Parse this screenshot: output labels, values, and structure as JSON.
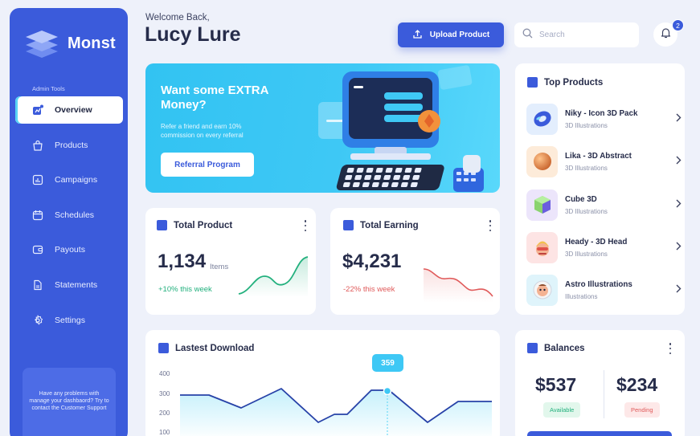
{
  "app": {
    "name": "Monst"
  },
  "sidebar": {
    "section_label": "Admin Tools",
    "items": [
      {
        "label": "Overview",
        "icon": "overview-icon",
        "active": true
      },
      {
        "label": "Products",
        "icon": "bag-icon"
      },
      {
        "label": "Campaigns",
        "icon": "chart-icon"
      },
      {
        "label": "Schedules",
        "icon": "calendar-icon"
      },
      {
        "label": "Payouts",
        "icon": "wallet-icon"
      },
      {
        "label": "Statements",
        "icon": "document-icon"
      },
      {
        "label": "Settings",
        "icon": "gear-icon"
      }
    ],
    "help_text": "Have any problems with manage your dashbaord? Try to contact the Customer Support"
  },
  "header": {
    "welcome": "Welcome Back,",
    "username": "Lucy Lure",
    "upload_label": "Upload Product",
    "search_placeholder": "Search",
    "notification_count": "2"
  },
  "promo": {
    "title": "Want some EXTRA Money?",
    "subtitle": "Refer a friend and earn 10% commission on every referral",
    "button": "Referral Program"
  },
  "total_product": {
    "title": "Total Product",
    "value": "1,134",
    "unit": "Items",
    "change": "+10% this week"
  },
  "total_earning": {
    "title": "Total Earning",
    "value": "$4,231",
    "change": "-22% this week"
  },
  "top_products": {
    "title": "Top Products",
    "items": [
      {
        "name": "Niky - Icon 3D Pack",
        "category": "3D Illustrations"
      },
      {
        "name": "Lika - 3D Abstract",
        "category": "3D Illustrations"
      },
      {
        "name": "Cube 3D",
        "category": "3D Illustrations"
      },
      {
        "name": "Heady - 3D Head",
        "category": "3D Illustrations"
      },
      {
        "name": "Astro Illustrations",
        "category": "Illustrations"
      }
    ]
  },
  "latest_download": {
    "title": "Lastest Download",
    "tooltip": "359",
    "y_ticks": [
      "400",
      "300",
      "200",
      "100"
    ]
  },
  "balances": {
    "title": "Balances",
    "available_value": "$537",
    "available_label": "Available",
    "pending_value": "$234",
    "pending_label": "Pending"
  },
  "colors": {
    "primary": "#3b5bdb",
    "accent": "#35c4f0",
    "positive": "#22b07d",
    "negative": "#e05a5a"
  }
}
